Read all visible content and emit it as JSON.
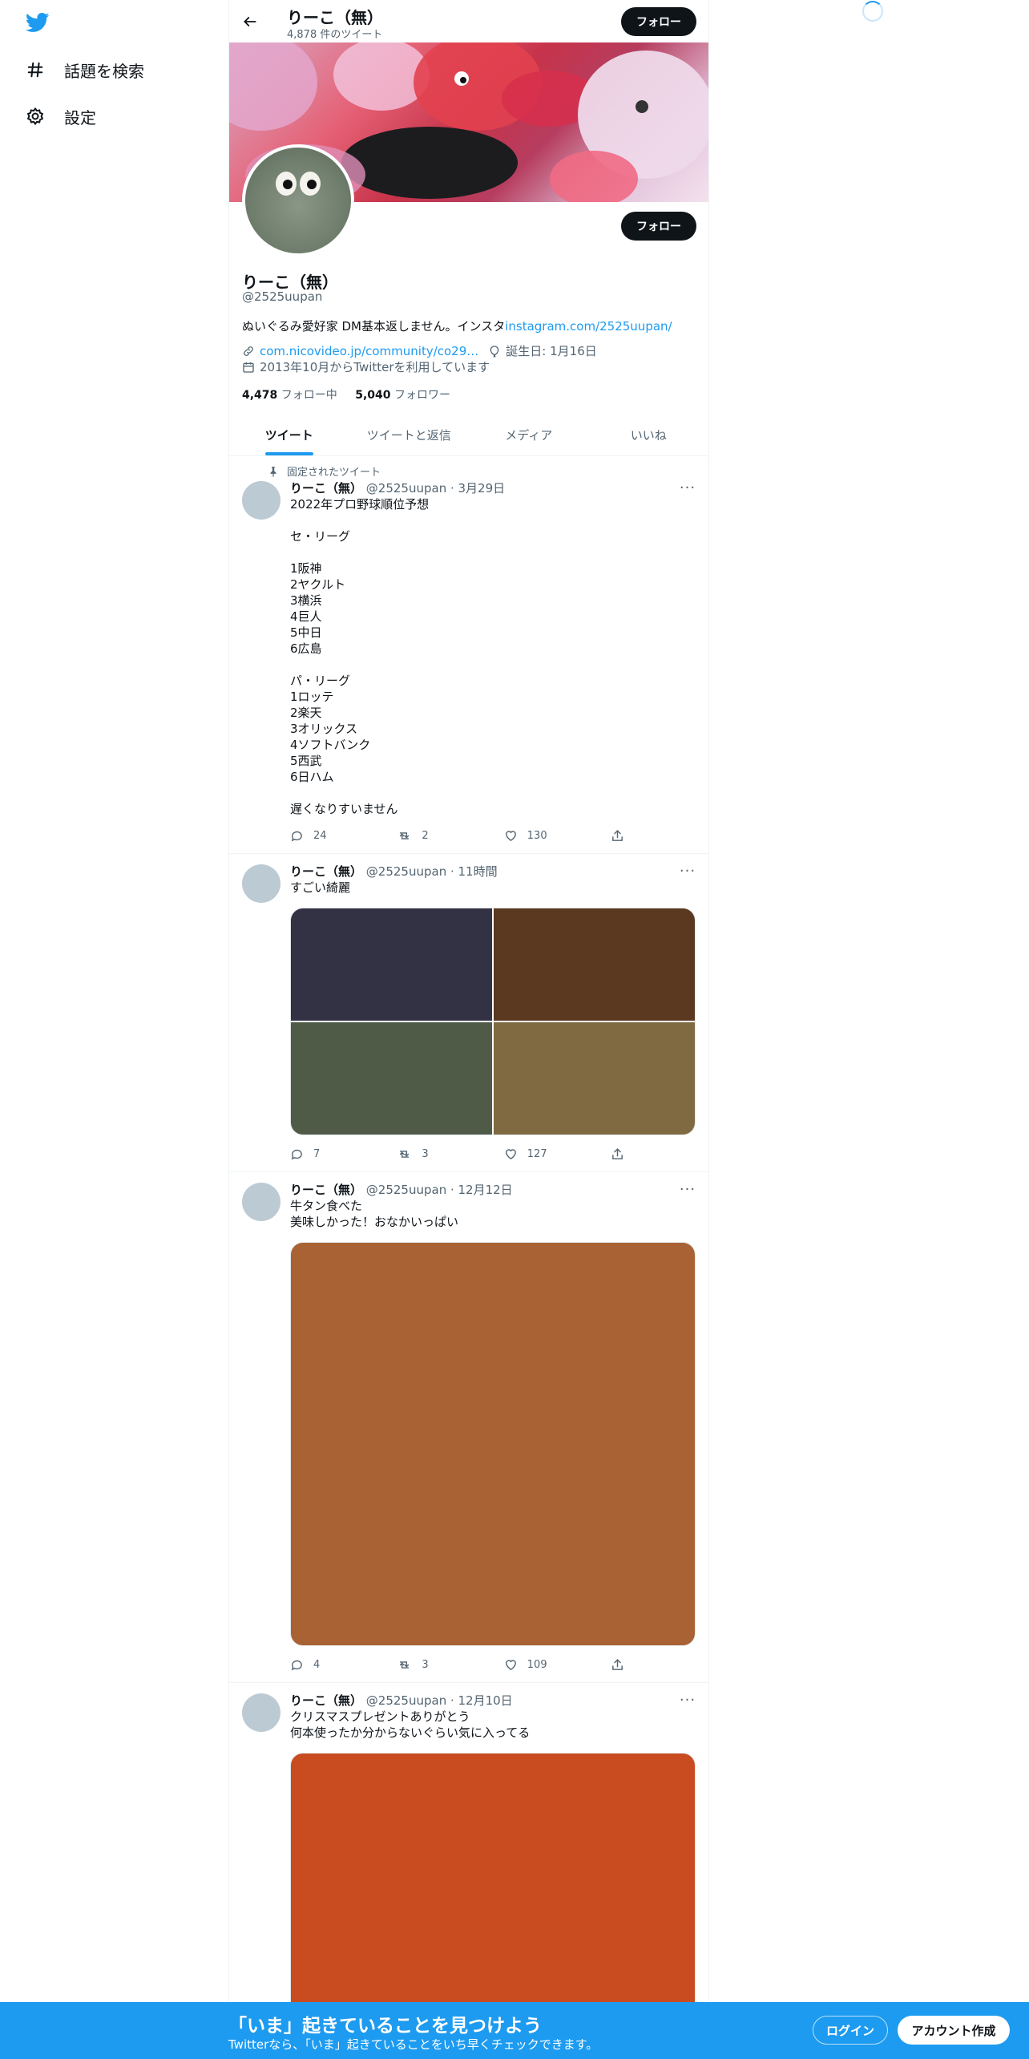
{
  "nav": {
    "logo_icon": "twitter-bird-icon",
    "items": [
      {
        "label": "話題を検索",
        "icon": "hashtag-icon"
      },
      {
        "label": "設定",
        "icon": "gear-icon"
      }
    ]
  },
  "topbar": {
    "name": "りーこ（無）",
    "tweet_count": "4,878 件のツイート",
    "follow_label": "フォロー"
  },
  "profile": {
    "name": "りーこ（無）",
    "handle": "@2525uupan",
    "bio_text": "ぬいぐるみ愛好家 DM基本返しません。インスタ",
    "bio_link": "instagram.com/2525uupan/",
    "website": "com.nicovideo.jp/community/co29…",
    "birthday": "誕生日: 1月16日",
    "joined": "2013年10月からTwitterを利用しています",
    "following_count": "4,478",
    "following_label": "フォロー中",
    "followers_count": "5,040",
    "followers_label": "フォロワー",
    "follow_label": "フォロー"
  },
  "tabs": [
    "ツイート",
    "ツイートと返信",
    "メディア",
    "いいね"
  ],
  "tweets": [
    {
      "pinned_label": "固定されたツイート",
      "name": "りーこ（無）",
      "meta": "@2525uupan · 3月29日",
      "text": "2022年プロ野球順位予想\n\nセ・リーグ\n\n1阪神\n2ヤクルト\n3横浜\n4巨人\n5中日\n6広島\n\nパ・リーグ\n1ロッテ\n2楽天\n3オリックス\n4ソフトバンク\n5西武\n6日ハム\n\n遅くなりすいません",
      "replies": "24",
      "retweets": "2",
      "likes": "130"
    },
    {
      "name": "りーこ（無）",
      "meta": "@2525uupan · 11時間",
      "text": "すごい綺麗",
      "replies": "7",
      "retweets": "3",
      "likes": "127",
      "media_colors": [
        "#323244",
        "#5b3921",
        "#4f5b47",
        "#7f6a42"
      ]
    },
    {
      "name": "りーこ（無）",
      "meta": "@2525uupan · 12月12日",
      "text": "牛タン食べた\n美味しかった！おなかいっぱい",
      "replies": "4",
      "retweets": "3",
      "likes": "109",
      "media_color": "#a86233"
    },
    {
      "name": "りーこ（無）",
      "meta": "@2525uupan · 12月10日",
      "text": "クリスマスプレゼントありがとう\n何本使ったか分からないぐらい気に入ってる",
      "media_color": "#c84c1f"
    }
  ],
  "bottom_bar": {
    "title": "「いま」起きていることを見つけよう",
    "subtitle": "Twitterなら、「いま」起きていることをいち早くチェックできます。",
    "login_label": "ログイン",
    "signup_label": "アカウント作成"
  },
  "colors": {
    "accent": "#1d9bf0",
    "text": "#0f1419",
    "muted": "#536471"
  }
}
